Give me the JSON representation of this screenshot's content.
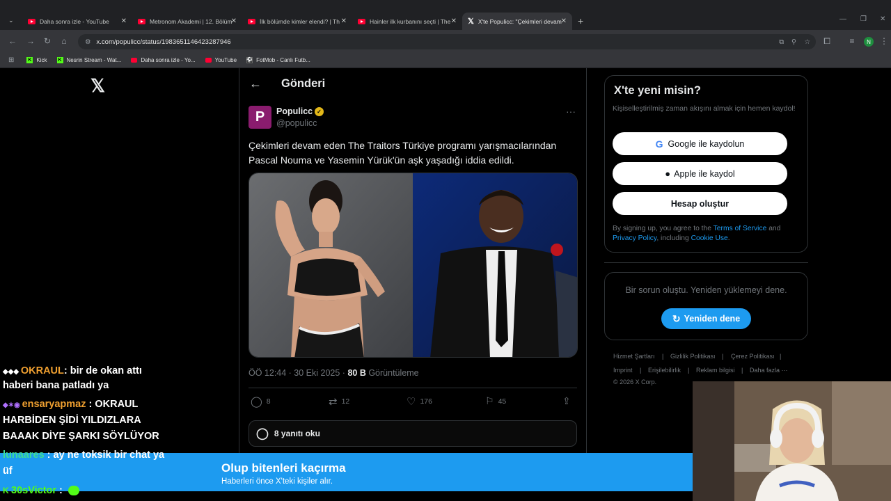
{
  "browser": {
    "tabs": [
      {
        "title": "Daha sonra izle - YouTube"
      },
      {
        "title": "Metronom Akademi | 12. Bölüm"
      },
      {
        "title": "İlk bölümde kimler elendi? | Th"
      },
      {
        "title": "Hainler ilk kurbanını seçti | The"
      },
      {
        "title": "X'te Populicc: \"Çekimleri devam"
      }
    ],
    "url": "x.com/populicc/status/1983651146423287946",
    "profile_initial": "N",
    "bookmarks": [
      {
        "label": "Kick",
        "icon": "kick-icon"
      },
      {
        "label": "Nesrin Stream - Wat...",
        "icon": "kick-icon"
      },
      {
        "label": "Daha sonra izle - Yo...",
        "icon": "youtube-icon"
      },
      {
        "label": "YouTube",
        "icon": "youtube-icon"
      },
      {
        "label": "FotMob - Canlı Futb...",
        "icon": "fotmob-icon"
      }
    ]
  },
  "x": {
    "logo": "𝕏",
    "header_title": "Gönderi",
    "post": {
      "avatar_letter": "P",
      "author_name": "Populicc",
      "handle": "@populicc",
      "more": "···",
      "text_line1": "Çekimleri devam eden The Traitors Türkiye programı yarışmacılarından",
      "text_line2": "Pascal Nouma ve Yasemin Yürük'ün aşk yaşadığı iddia edildi.",
      "time": "ÖÖ 12:44 · 30 Eki 2025 · ",
      "views_count": "80 B",
      "views_label": " Görüntüleme",
      "replies": "8",
      "reposts": "12",
      "likes": "176",
      "bookmarks": "45",
      "read_replies": "8 yanıtı oku"
    },
    "signup": {
      "title": "X'te yeni misin?",
      "subtitle": "Kişiselleştirilmiş zaman akışını almak için hemen kaydol!",
      "google": "Google ile kaydolun",
      "apple": "Apple ile kaydol",
      "create": "Hesap oluştur",
      "legal_prefix": "By signing up, you agree to the ",
      "terms": "Terms of Service",
      "and": " and",
      "privacy": "Privacy Policy",
      "including": ", including ",
      "cookie": "Cookie Use",
      "period": "."
    },
    "error": {
      "message": "Bir sorun oluştu. Yeniden yüklemeyi dene.",
      "retry": "Yeniden dene"
    },
    "footer": {
      "links": [
        "Hizmet Şartları",
        "|",
        "Gizlilik Politikası",
        "|",
        "Çerez Politikası",
        "|"
      ],
      "links2": [
        "Imprint",
        "|",
        "Erişilebilirlik",
        "|",
        "Reklam bilgisi",
        "|",
        "Daha fazla ···"
      ],
      "copyright": "© 2026 X Corp."
    },
    "banner": {
      "title": "Olup bitenleri kaçırma",
      "subtitle": "Haberleri önce X'teki kişiler alır."
    }
  },
  "chat": {
    "messages": [
      {
        "user": "OKRAUL",
        "text": ": bir de okan attı",
        "cont": "haberi bana patladı ya",
        "color": "#f0a030"
      },
      {
        "user": "ensaryapmaz",
        "text": " : OKRAUL",
        "cont": "HARBİDEN ŞİDİ YILDIZLARA",
        "cont2": "BAAAK DİYE ŞARKI SÖYLÜYOR",
        "color": "#f0a030"
      },
      {
        "user": "lunaares",
        "text": " : ay ne toksik bir chat ya",
        "cont": "üf",
        "color": "#3ddc97"
      },
      {
        "user": "30sVictor",
        "text": " :",
        "color": "#53fc18"
      }
    ]
  },
  "colors": {
    "accent": "#1d9bf0",
    "verified": "#e2b719",
    "brand_avatar": "#8a1c6e"
  }
}
